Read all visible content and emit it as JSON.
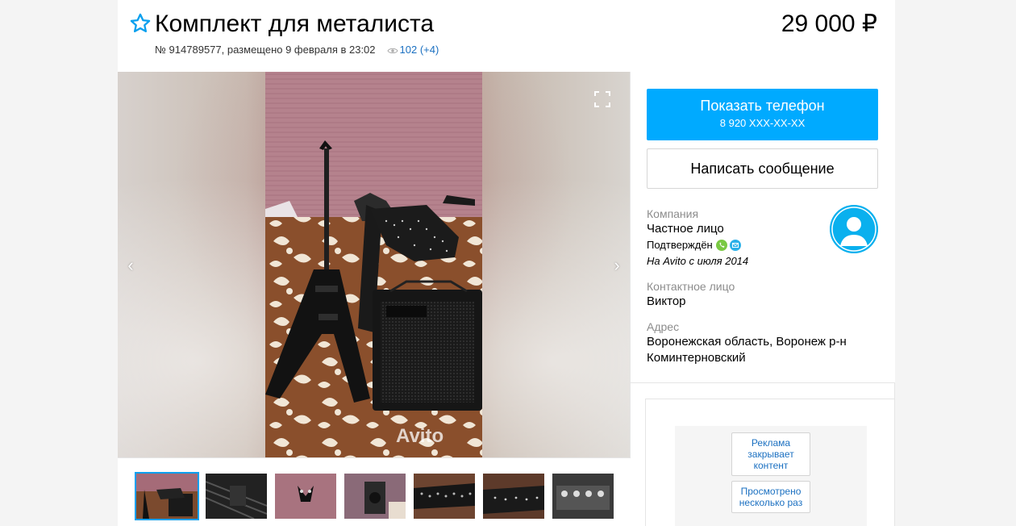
{
  "listing": {
    "title": "Комплект для металиста",
    "price": "29 000 ₽",
    "meta": "№ 914789577, размещено 9 февраля в 23:02",
    "views": "102 (+4)"
  },
  "gallery": {
    "watermark": "Avito",
    "thumbnail_count": 7,
    "active_thumbnail_index": 0
  },
  "sidebar": {
    "phone_button_label": "Показать телефон",
    "phone_number_masked": "8 920 XXX-XX-XX",
    "message_button_label": "Написать сообщение",
    "company_label": "Компания",
    "company_value": "Частное лицо",
    "verified_label": "Подтверждён",
    "member_since": "На Avito с июля 2014",
    "contact_label": "Контактное лицо",
    "contact_value": "Виктор",
    "address_label": "Адрес",
    "address_line1": "Воронежская область, Воронеж р-н",
    "address_line2": "Коминтерновский"
  },
  "ad_feedback": {
    "btn1": "Реклама закрывает контент",
    "btn2": "Просмотрено несколько раз"
  },
  "colors": {
    "accent": "#00aaff",
    "link": "#1b70c1",
    "avatar": "#0ab0ee",
    "thumb_active_border": "#0aa0ee"
  }
}
